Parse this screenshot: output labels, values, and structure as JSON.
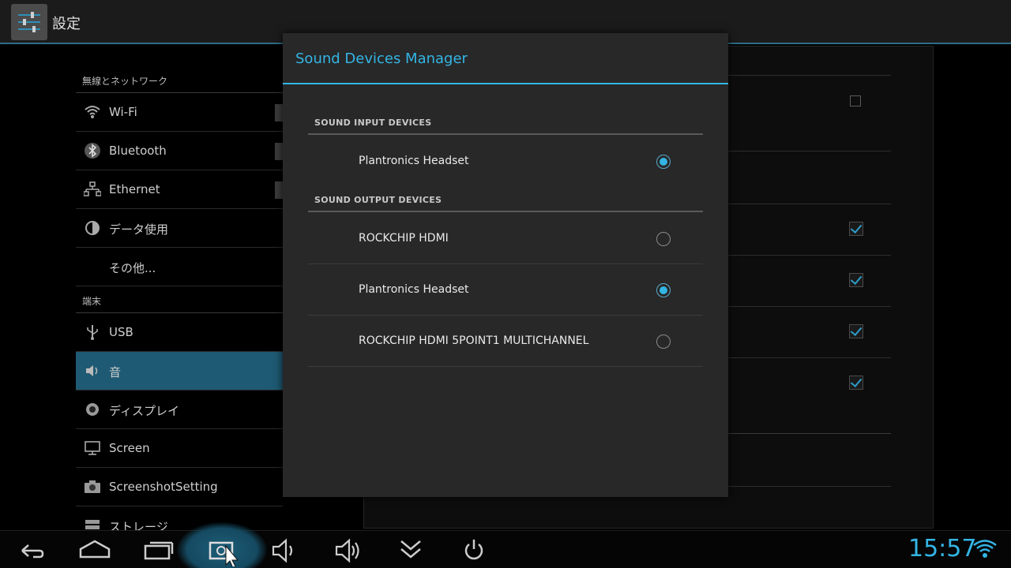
{
  "actionbar": {
    "title": "設定",
    "icon": "settings-sliders-icon"
  },
  "left_list": {
    "categories": [
      {
        "label": "無線とネットワーク"
      },
      {
        "label": "端末"
      }
    ],
    "items": [
      {
        "label": "Wi-Fi",
        "icon": "wifi-icon"
      },
      {
        "label": "Bluetooth",
        "icon": "bluetooth-icon"
      },
      {
        "label": "Ethernet",
        "icon": "ethernet-icon"
      },
      {
        "label": "データ使用",
        "icon": "data-usage-icon"
      },
      {
        "label": "その他...",
        "icon": ""
      },
      {
        "label": "USB",
        "icon": "usb-icon"
      },
      {
        "label": "音",
        "icon": "speaker-icon",
        "selected": true
      },
      {
        "label": "ディスプレイ",
        "icon": "display-brightness-icon"
      },
      {
        "label": "Screen",
        "icon": "monitor-icon"
      },
      {
        "label": "ScreenshotSetting",
        "icon": "camera-icon"
      },
      {
        "label": "ストレージ",
        "icon": "storage-icon"
      }
    ]
  },
  "dialog": {
    "title": "Sound Devices Manager",
    "input_header": "SOUND INPUT DEVICES",
    "input_devices": [
      {
        "label": "Plantronics Headset",
        "selected": true
      }
    ],
    "output_header": "SOUND OUTPUT DEVICES",
    "output_devices": [
      {
        "label": "ROCKCHIP HDMI",
        "selected": false
      },
      {
        "label": "Plantronics Headset",
        "selected": true
      },
      {
        "label": "ROCKCHIP HDMI 5POINT1 MULTICHANNEL",
        "selected": false
      }
    ]
  },
  "navbar": {
    "buttons": [
      "back-icon",
      "home-icon",
      "recent-apps-icon",
      "screenshot-icon",
      "volume-down-icon",
      "volume-up-icon",
      "collapse-icon",
      "power-icon"
    ],
    "clock": "15:57",
    "status_icon": "wifi-signal-icon",
    "accent_color": "#33b5e5"
  }
}
